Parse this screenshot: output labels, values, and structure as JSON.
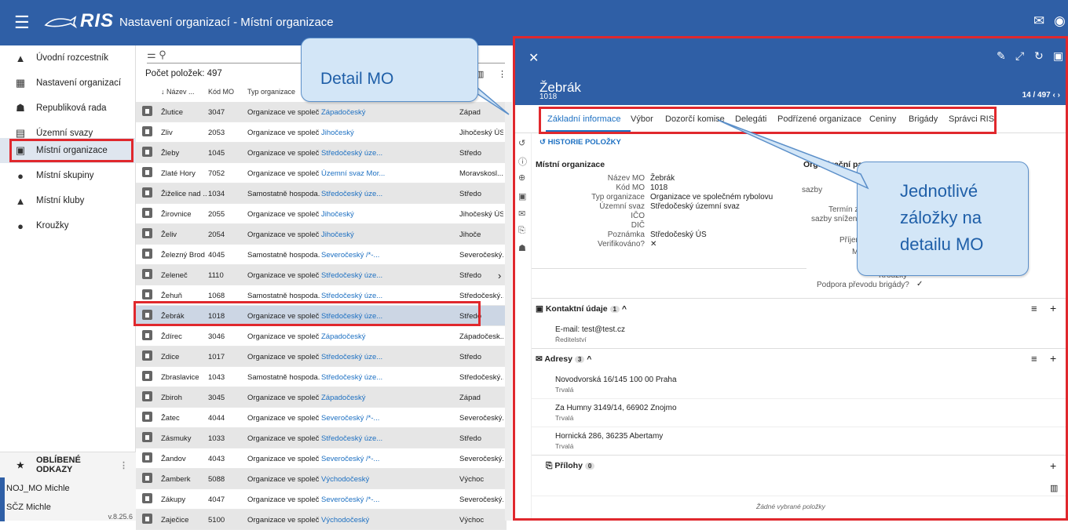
{
  "header": {
    "app_name": "RIS",
    "title": "Nastavení organizací - Místní organizace",
    "menu_icon": "☰",
    "mail_icon": "✉",
    "account_icon": "◉"
  },
  "sidebar": {
    "items": [
      {
        "icon": "▲",
        "label": "Úvodní rozcestník"
      },
      {
        "icon": "▦",
        "label": "Nastavení organizací"
      },
      {
        "icon": "☗",
        "label": "Republiková rada"
      },
      {
        "icon": "▤",
        "label": "Územní svazy"
      },
      {
        "icon": "▣",
        "label": "Místní organizace"
      },
      {
        "icon": "●",
        "label": "Místní skupiny"
      },
      {
        "icon": "▲",
        "label": "Místní kluby"
      },
      {
        "icon": "●",
        "label": "Kroužky"
      }
    ],
    "favorites": {
      "title": "OBLÍBENÉ ODKAZY",
      "links": [
        "NOJ_MO Michle",
        "SČZ Michle"
      ],
      "version": "v.8.25.6"
    }
  },
  "list": {
    "search_icon": "⚲",
    "count": "Počet položek: 497",
    "columns": [
      "↓ Název ...",
      "Kód MO",
      "Typ organizace"
    ],
    "rows": [
      [
        "Žlutice",
        "3047",
        "Organizace ve společ...",
        "Západočeský",
        "Západ"
      ],
      [
        "Zliv",
        "2053",
        "Organizace ve společ...",
        "Jihočeský",
        "Jihočeský ÚS"
      ],
      [
        "Žleby",
        "1045",
        "Organizace ve společ...",
        "Středočeský úze...",
        "Středo"
      ],
      [
        "Zlaté Hory",
        "7052",
        "Organizace ve společ...",
        "Územní svaz Mor...",
        "Moravskosl..."
      ],
      [
        "Žiželice nad ...",
        "1034",
        "Samostatně hospoda...",
        "Středočeský úze...",
        "Středo"
      ],
      [
        "Žirovnice",
        "2055",
        "Organizace ve společ...",
        "Jihočeský",
        "Jihočeský ÚS"
      ],
      [
        "Želiv",
        "2054",
        "Organizace ve společ...",
        "Jihočeský",
        "Jihoče"
      ],
      [
        "Železný Brod",
        "4045",
        "Samostatně hospoda...",
        "Severočeský /*-...",
        "Severočeský..."
      ],
      [
        "Zeleneč",
        "1110",
        "Organizace ve společ...",
        "Středočeský úze...",
        "Středo"
      ],
      [
        "Žehuň",
        "1068",
        "Samostatně hospoda...",
        "Středočeský úze...",
        "Středočeský..."
      ],
      [
        "Žebrák",
        "1018",
        "Organizace ve společ...",
        "Středočeský úze...",
        "Středo"
      ],
      [
        "Ždírec",
        "3046",
        "Organizace ve společ...",
        "Západočeský",
        "Západočesk..."
      ],
      [
        "Zdice",
        "1017",
        "Organizace ve společ...",
        "Středočeský úze...",
        "Středo"
      ],
      [
        "Zbraslavice",
        "1043",
        "Samostatně hospoda...",
        "Středočeský úze...",
        "Středočeský..."
      ],
      [
        "Zbiroh",
        "3045",
        "Organizace ve společ...",
        "Západočeský",
        "Západ"
      ],
      [
        "Žatec",
        "4044",
        "Organizace ve společ...",
        "Severočeský /*-...",
        "Severočeský..."
      ],
      [
        "Zásmuky",
        "1033",
        "Organizace ve společ...",
        "Středočeský úze...",
        "Středo"
      ],
      [
        "Žandov",
        "4043",
        "Organizace ve společ...",
        "Severočeský /*-...",
        "Severočeský..."
      ],
      [
        "Žamberk",
        "5088",
        "Organizace ve společ...",
        "Východočeský",
        "Výchoc"
      ],
      [
        "Zákupy",
        "4047",
        "Organizace ve společ...",
        "Severočeský /*-...",
        "Severočeský..."
      ],
      [
        "Zaječice",
        "5100",
        "Organizace ve společ...",
        "Východočeský",
        "Výchoc"
      ]
    ]
  },
  "detail": {
    "name": "Žebrák",
    "code": "1018",
    "pager": "14 / 497",
    "tabs": [
      "Základní informace",
      "Výbor",
      "Dozorčí komise",
      "Delegáti",
      "Podřízené organizace",
      "Ceniny",
      "Brigády",
      "Správci RIS"
    ],
    "history": "HISTORIE POLOŽKY",
    "section_title": "Místní organizace",
    "fields": [
      {
        "label": "Název MO",
        "value": "Žebrák"
      },
      {
        "label": "Kód MO",
        "value": "1018"
      },
      {
        "label": "Typ organizace",
        "value": "Organizace ve společném rybolovu"
      },
      {
        "label": "Územní svaz",
        "value": "Středočeský územní svaz"
      },
      {
        "label": "IČO",
        "value": ""
      },
      {
        "label": "DIČ",
        "value": ""
      },
      {
        "label": "Poznámka",
        "value": "Středočeský ÚS"
      },
      {
        "label": "Verifikováno?",
        "value": "✕"
      }
    ],
    "params_title": "Organizační paramet",
    "params_partial": [
      "sazby",
      "Termín zapla",
      "sazby sníženého",
      "Příjem el.",
      "Místn",
      "Mi",
      "Kroužky"
    ],
    "support": "Podpora převodu brigády?",
    "support_value": "✓",
    "contacts": {
      "title": "Kontaktní údaje",
      "count": "1",
      "email": "E-mail: test@test.cz",
      "role": "Ředitelství"
    },
    "addresses": {
      "title": "Adresy",
      "count": "3",
      "items": [
        {
          "text": "Novodvorská 16/145 100 00 Praha",
          "type": "Trvalá"
        },
        {
          "text": "Za Humny 3149/14, 66902 Znojmo",
          "type": "Trvalá"
        },
        {
          "text": "Hornická 286, 36235 Abertamy",
          "type": "Trvalá"
        }
      ]
    },
    "attachments": {
      "title": "Přílohy",
      "count": "0",
      "empty": "Žádné vybrané položky"
    }
  },
  "callouts": {
    "detail": "Detail MO",
    "tabs_line1": "Jednotlivé",
    "tabs_line2": "záložky na",
    "tabs_line3": "detailu MO"
  }
}
